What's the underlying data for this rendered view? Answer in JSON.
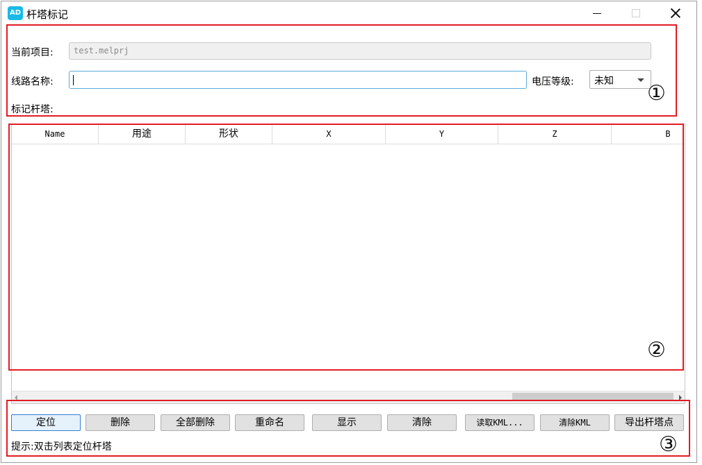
{
  "window": {
    "title": "杆塔标记",
    "icon_text": "AD"
  },
  "form": {
    "project_label": "当前项目:",
    "project_value": "test.melprj",
    "line_name_label": "线路名称:",
    "line_name_value": "",
    "voltage_label": "电压等级:",
    "voltage_value": "未知",
    "mark_towers_label": "标记杆塔:"
  },
  "table": {
    "columns": [
      "Name",
      "用途",
      "形状",
      "X",
      "Y",
      "Z",
      "B"
    ],
    "rows": []
  },
  "buttons": {
    "locate": "定位",
    "delete": "删除",
    "delete_all": "全部删除",
    "rename": "重命名",
    "show": "显示",
    "clear": "清除",
    "read_kml": "读取KML...",
    "clear_kml": "清除KML",
    "export_towers": "导出杆塔点"
  },
  "hint": "提示:双击列表定位杆塔",
  "annotations": {
    "n1": "①",
    "n2": "②",
    "n3": "③"
  },
  "colors": {
    "annotation_red": "#e21b23",
    "focus_blue": "#5aa8d8",
    "primary_button_border": "#2f7fd4"
  }
}
